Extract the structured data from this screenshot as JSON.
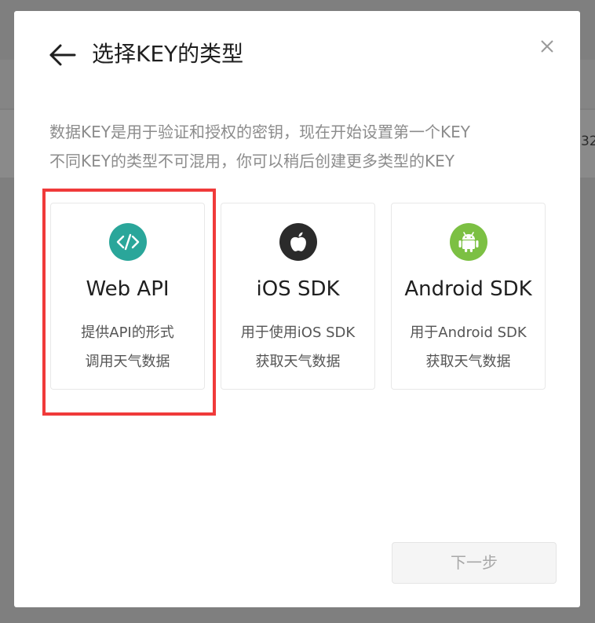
{
  "background": {
    "peek_text": "32"
  },
  "dialog": {
    "title": "选择KEY的类型",
    "description": [
      "数据KEY是用于验证和授权的密钥，现在开始设置第一个KEY",
      "不同KEY的类型不可混用，你可以稍后创建更多类型的KEY"
    ],
    "cards": [
      {
        "title": "Web API",
        "desc1": "提供API的形式",
        "desc2": "调用天气数据",
        "icon": "code-icon",
        "color": "#2aa69a",
        "selected": true
      },
      {
        "title": "iOS SDK",
        "desc1": "用于使用iOS SDK",
        "desc2": "获取天气数据",
        "icon": "apple-icon",
        "color": "#2b2b2b",
        "selected": false
      },
      {
        "title": "Android SDK",
        "desc1": "用于Android SDK",
        "desc2": "获取天气数据",
        "icon": "android-icon",
        "color": "#7cc043",
        "selected": false
      }
    ],
    "next_label": "下一步",
    "highlight_color": "#f03a3a"
  }
}
